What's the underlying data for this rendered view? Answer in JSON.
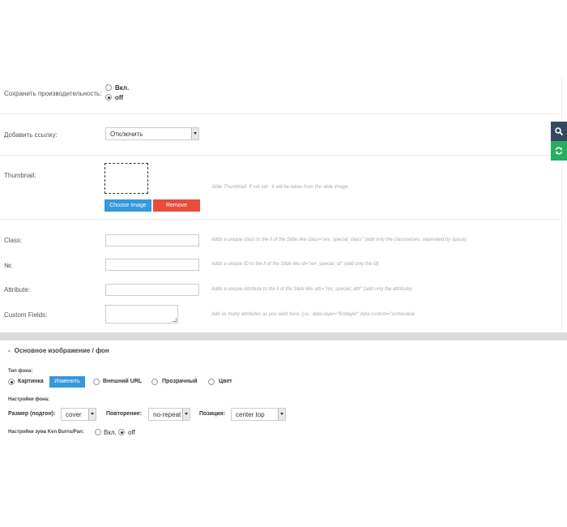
{
  "performance": {
    "label": "Сохранить производительность:",
    "options": [
      "Вкл.",
      "off"
    ],
    "selected": "off"
  },
  "link": {
    "label": "Добавить ссылку:",
    "value": "Отключить"
  },
  "thumbnail": {
    "label": "Thumbnail:",
    "hint": "Slide Thumbnail. If not set - it will be taken from the slide image.",
    "choose_label": "Choose Image",
    "remove_label": "Remove"
  },
  "class_field": {
    "label": "Class:",
    "value": "",
    "hint": "Adds a unique class to the li of the Slide like class=\"rev_special_class\" (add only the classnames, seperated by space)"
  },
  "id_field": {
    "label": "№:",
    "value": "",
    "hint": "Adds a unique ID to the li of the Slide like id=\"rev_special_id\" (add only the id)"
  },
  "attribute_field": {
    "label": "Attribute:",
    "value": "",
    "hint": "Adds a unique Attribute to the li of the Slide like attr=\"rev_special_attr\" (add only the attribute)"
  },
  "custom_fields": {
    "label": "Custom Fields:",
    "value": "",
    "hint": "Add as many attributes as you wish here. (i.e.: data-layer=\"firstlayer\" data-custom=\"somevalue"
  },
  "bg_section": {
    "title": "Основное изображение / фон",
    "type_label": "Тип фона:",
    "types": [
      "Картинка",
      "Внешний URL",
      "Прозрачный",
      "Цвет"
    ],
    "selected_type": "Картинка",
    "change_label": "Изменить",
    "settings_label": "Настройки фона:",
    "size_label": "Размер (подгон):",
    "size_value": "cover",
    "repeat_label": "Повторение:",
    "repeat_value": "no-repeat",
    "position_label": "Позиция:",
    "position_value": "center top",
    "kenburns_label": "Настройки зума Ken Burns/Pan:",
    "kenburns_options": [
      "Вкл.",
      "off"
    ],
    "kenburns_selected": "off"
  },
  "side_tabs": {
    "search": "search-icon",
    "refresh": "refresh-icon"
  },
  "colors": {
    "accent_blue": "#3498db",
    "remove_red": "#e74c3c",
    "tab_dark": "#34495e",
    "tab_green": "#27ae60"
  }
}
